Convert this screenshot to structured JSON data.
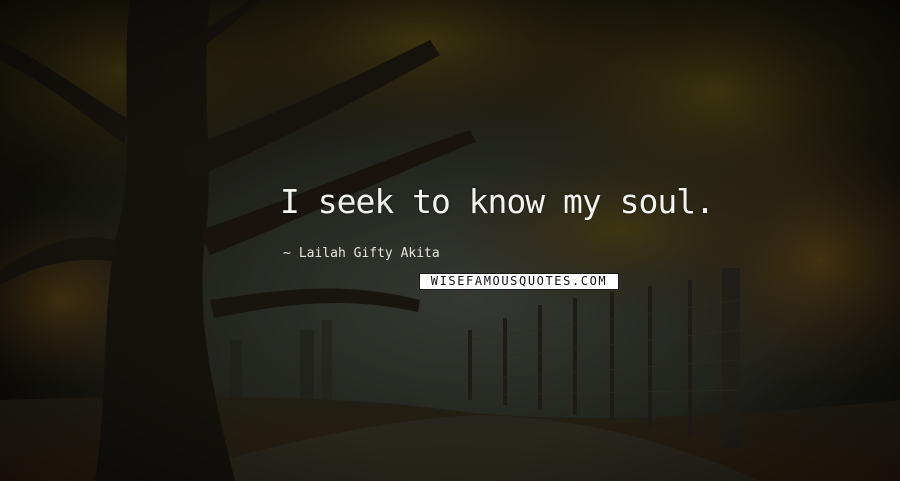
{
  "quote": {
    "text": "I seek to know my soul.",
    "author_dash": "~",
    "author": "Lailah Gifty Akita"
  },
  "watermark": {
    "text": "WISEFAMOUSQUOTES.COM"
  },
  "colors": {
    "text": "#f2f2ee",
    "foliage": "#4a3e14",
    "fog": "#3a3d36"
  }
}
